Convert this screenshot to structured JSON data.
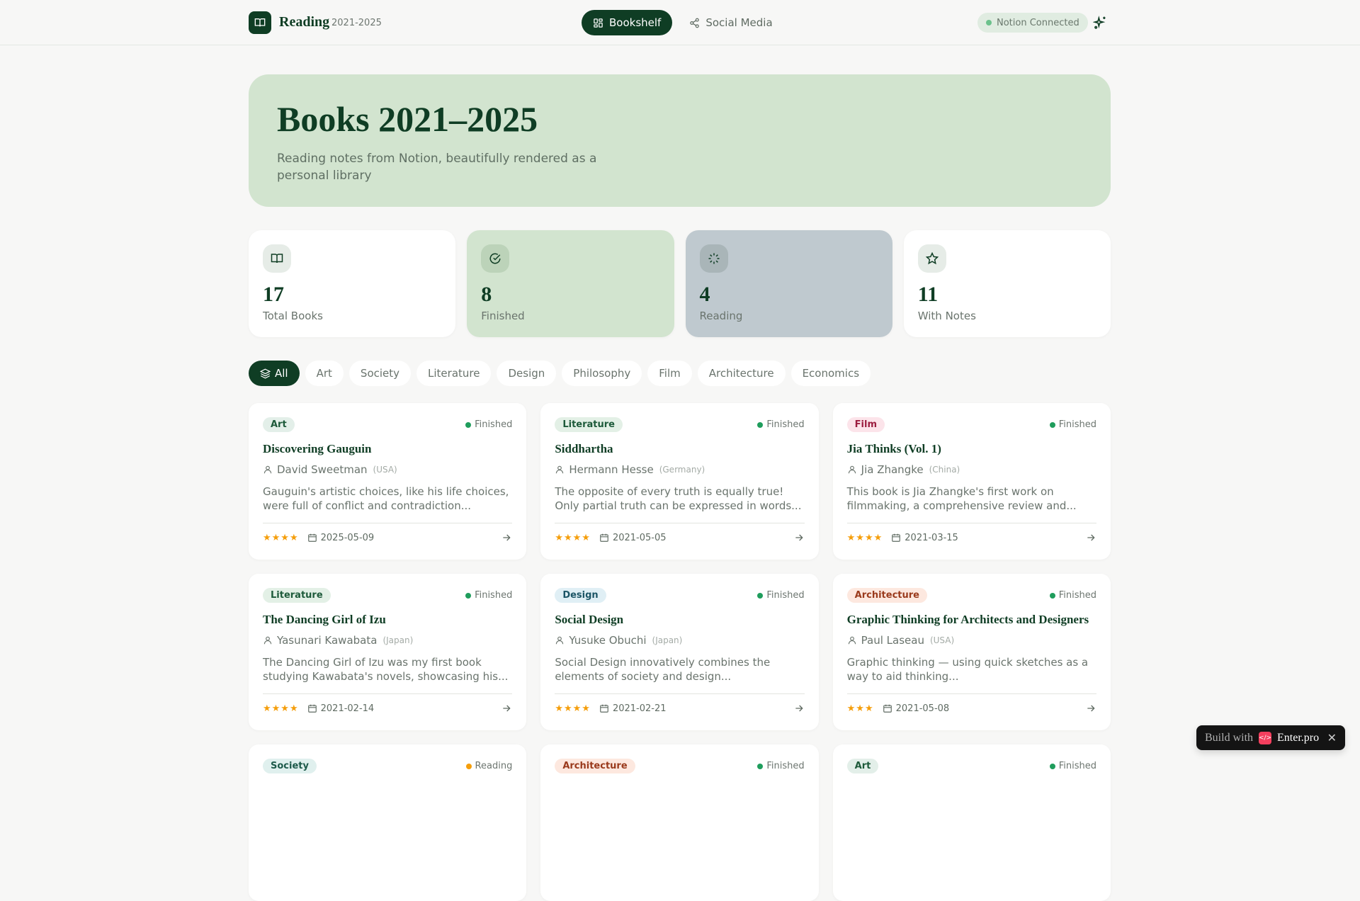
{
  "header": {
    "brand": "Reading",
    "years": "2021-2025",
    "nav": [
      {
        "label": "Bookshelf",
        "icon": "grid-icon",
        "active": true
      },
      {
        "label": "Social Media",
        "icon": "share-icon",
        "active": false
      }
    ],
    "status": "Notion Connected"
  },
  "hero": {
    "title": "Books 2021–2025",
    "subtitle": "Reading notes from Notion, beautifully rendered as a personal library"
  },
  "stats": [
    {
      "value": "17",
      "label": "Total Books"
    },
    {
      "value": "8",
      "label": "Finished"
    },
    {
      "value": "4",
      "label": "Reading"
    },
    {
      "value": "11",
      "label": "With Notes"
    }
  ],
  "filters": [
    "All",
    "Art",
    "Society",
    "Literature",
    "Design",
    "Philosophy",
    "Film",
    "Architecture",
    "Economics"
  ],
  "books": [
    {
      "category": "Art",
      "status": "Finished",
      "title": "Discovering Gauguin",
      "author": "David Sweetman",
      "country": "(USA)",
      "desc": "Gauguin's artistic choices, like his life choices, were full of conflict and contradiction...",
      "rating": 4,
      "stars": "★★★★",
      "date": "2025-05-09"
    },
    {
      "category": "Literature",
      "status": "Finished",
      "title": "Siddhartha",
      "author": "Hermann Hesse",
      "country": "(Germany)",
      "desc": "The opposite of every truth is equally true! Only partial truth can be expressed in words...",
      "rating": 4,
      "stars": "★★★★",
      "date": "2021-05-05"
    },
    {
      "category": "Film",
      "status": "Finished",
      "title": "Jia Thinks (Vol. 1)",
      "author": "Jia Zhangke",
      "country": "(China)",
      "desc": "This book is Jia Zhangke's first work on filmmaking, a comprehensive review and...",
      "rating": 4,
      "stars": "★★★★",
      "date": "2021-03-15"
    },
    {
      "category": "Literature",
      "status": "Finished",
      "title": "The Dancing Girl of Izu",
      "author": "Yasunari Kawabata",
      "country": "(Japan)",
      "desc": "The Dancing Girl of Izu was my first book studying Kawabata's novels, showcasing his...",
      "rating": 4,
      "stars": "★★★★",
      "date": "2021-02-14"
    },
    {
      "category": "Design",
      "status": "Finished",
      "title": "Social Design",
      "author": "Yusuke Obuchi",
      "country": "(Japan)",
      "desc": "Social Design innovatively combines the elements of society and design...",
      "rating": 4,
      "stars": "★★★★",
      "date": "2021-02-21"
    },
    {
      "category": "Architecture",
      "status": "Finished",
      "title": "Graphic Thinking for Architects and Designers",
      "author": "Paul Laseau",
      "country": "(USA)",
      "desc": "Graphic thinking — using quick sketches as a way to aid thinking...",
      "rating": 3,
      "stars": "★★★",
      "date": "2021-05-08"
    },
    {
      "category": "Society",
      "status": "Reading"
    },
    {
      "category": "Architecture",
      "status": "Finished"
    },
    {
      "category": "Art",
      "status": "Finished"
    }
  ],
  "badge": {
    "prefix": "Build with",
    "name": "Enter.pro"
  },
  "colors": {
    "primary": "#0f3d24",
    "hero": "#d2e4cf",
    "finished": "#1f9d5c",
    "reading": "#f59e0b"
  }
}
